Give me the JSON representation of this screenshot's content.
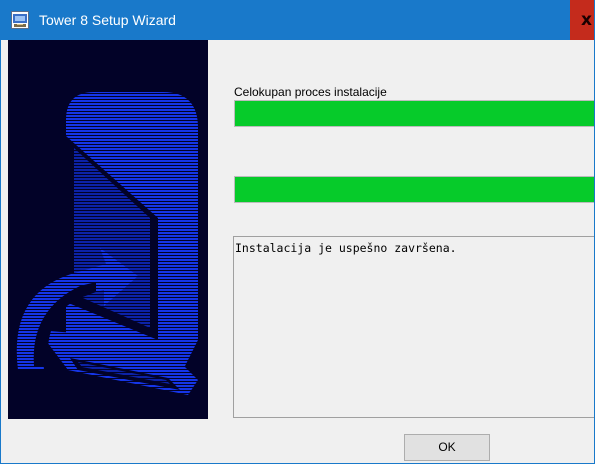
{
  "window": {
    "title": "Tower 8 Setup Wizard",
    "close_glyph": "x",
    "icon": "setup-app-icon"
  },
  "main": {
    "overall_label": "Celokupan proces instalacije",
    "overall_progress": 1.0,
    "step_progress": 1.0,
    "message": "Instalacija je uspešno završena.",
    "progress_color": "#06cb2a"
  },
  "buttons": {
    "ok_label": "OK"
  },
  "colors": {
    "titlebar": "#1979ca",
    "close_button": "#c42b1c",
    "art_background": "#020228",
    "art_foreground": "#1535e8"
  }
}
